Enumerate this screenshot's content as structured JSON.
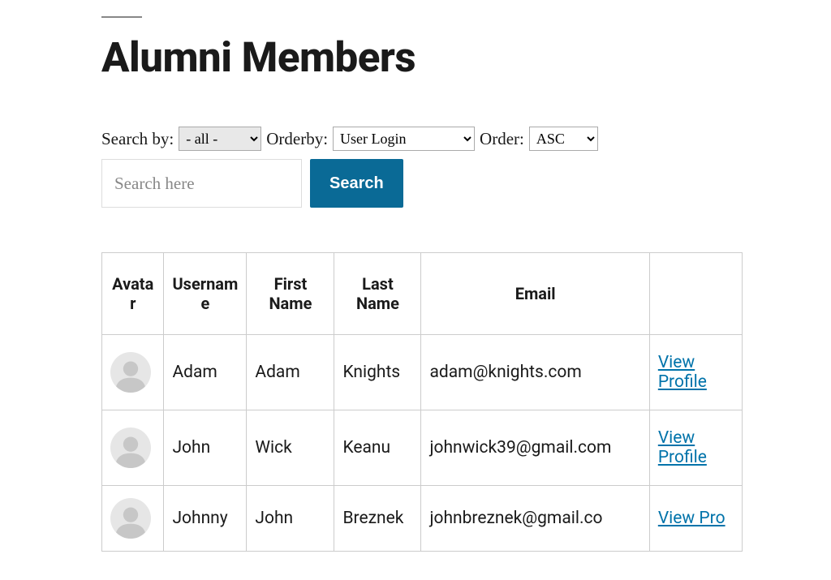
{
  "page": {
    "title": "Alumni Members"
  },
  "filters": {
    "search_by_label": "Search by:",
    "search_by_value": "- all -",
    "orderby_label": "Orderby:",
    "orderby_value": "User Login",
    "order_label": "Order:",
    "order_value": "ASC",
    "search_placeholder": "Search here",
    "search_button": "Search"
  },
  "table": {
    "headers": {
      "avatar": "Avatar",
      "username": "Username",
      "first_name": "First Name",
      "last_name": "Last Name",
      "email": "Email",
      "action": ""
    },
    "rows": [
      {
        "username": "Adam",
        "first_name": "Adam",
        "last_name": "Knights",
        "email": "adam@knights.com",
        "action": "View Profile"
      },
      {
        "username": "John",
        "first_name": "Wick",
        "last_name": "Keanu",
        "email": "johnwick39@gmail.com",
        "action": "View Profile"
      },
      {
        "username": "Johnny",
        "first_name": "John",
        "last_name": "Breznek",
        "email": "johnbreznek@gmail.co",
        "action": "View Pro"
      }
    ]
  }
}
